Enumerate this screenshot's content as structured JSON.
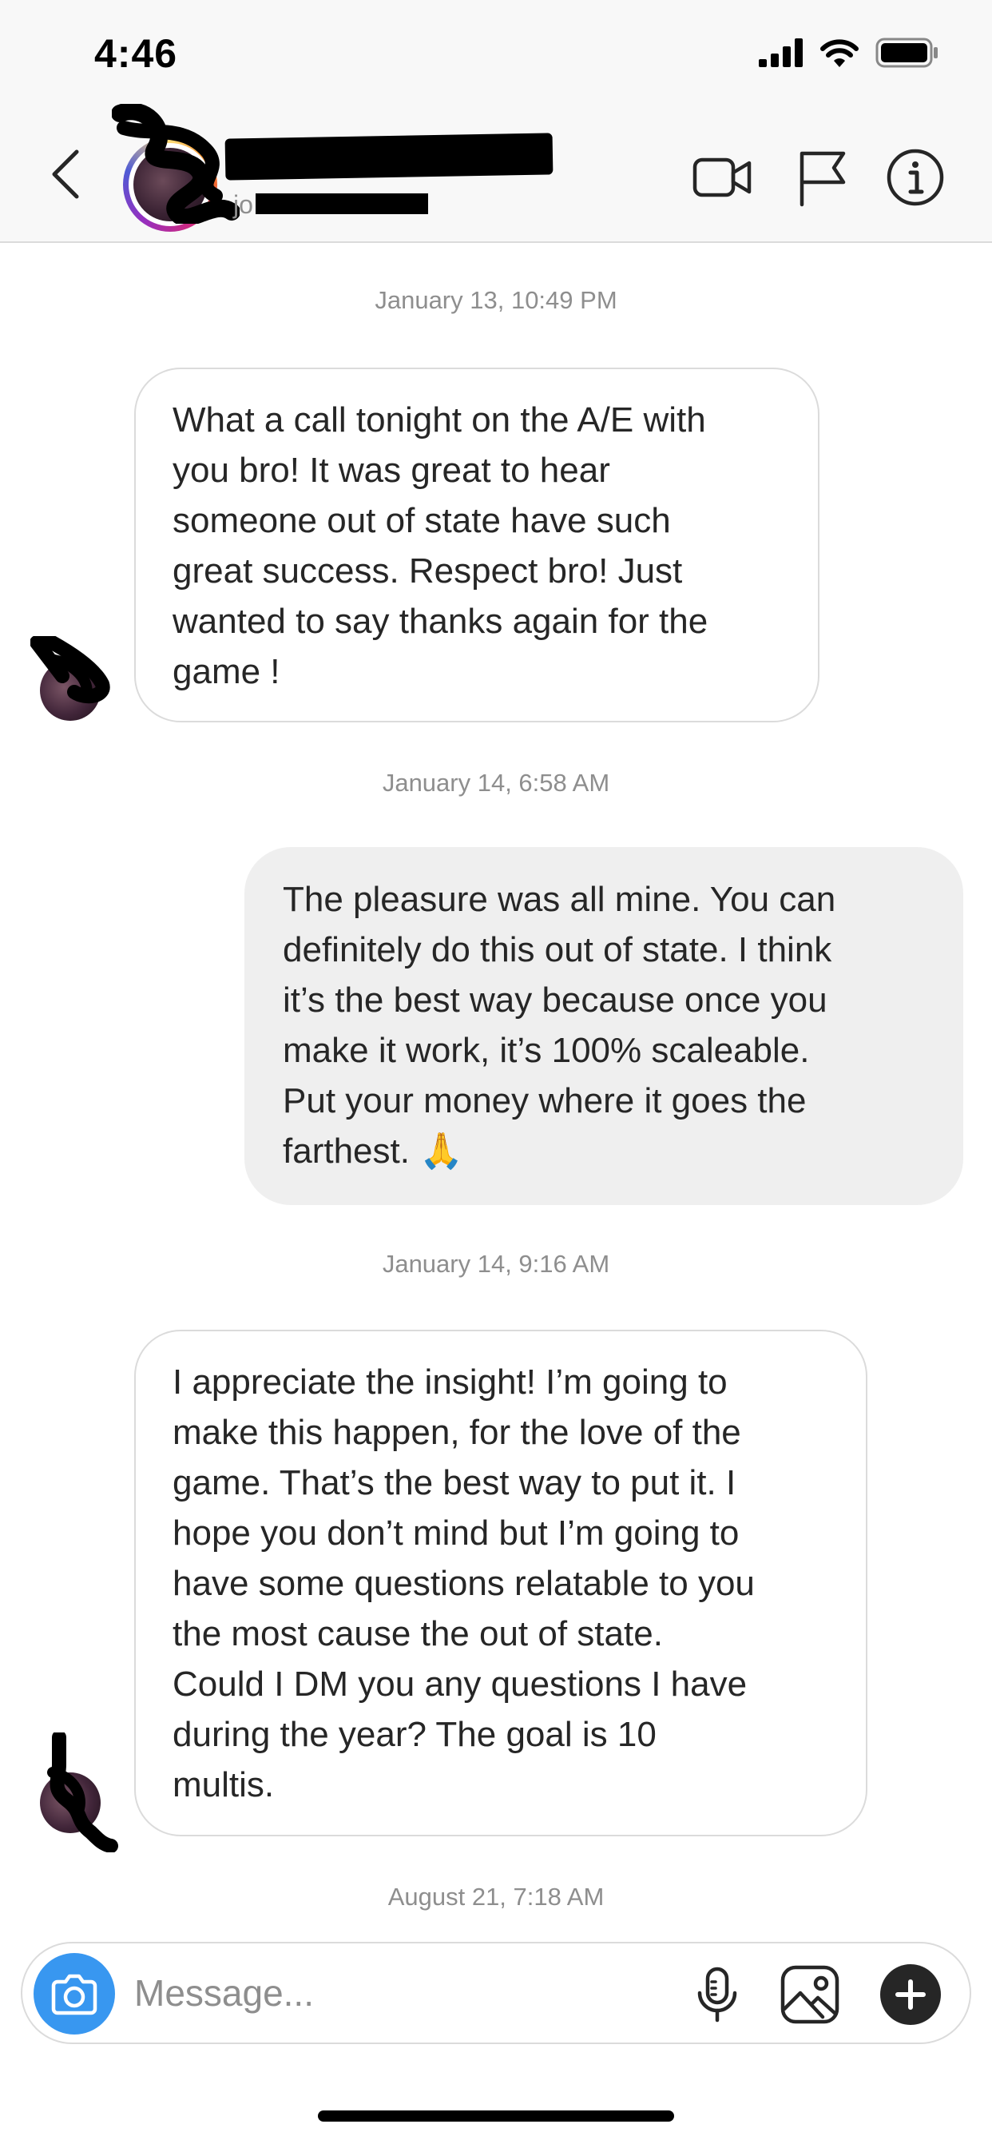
{
  "status_bar": {
    "time": "4:46",
    "icons": [
      "cellular-signal-icon",
      "wifi-icon",
      "battery-icon"
    ]
  },
  "header": {
    "name": "",
    "username": "jo",
    "actions": [
      "video-call-icon",
      "flag-icon",
      "info-icon"
    ],
    "colors": {
      "background": "#f8f8f8",
      "divider": "#dbdbdb"
    }
  },
  "thread": {
    "messages": [
      {
        "timestamp": "January 13, 10:49 PM",
        "direction": "received",
        "lines": [
          "What a call tonight on the A/E with",
          "you bro! It was great to hear",
          "someone out of state have such",
          "great success. Respect bro! Just",
          "wanted to say thanks again for the",
          "game !"
        ]
      },
      {
        "timestamp": "January 14, 6:58 AM",
        "direction": "sent",
        "lines": [
          "The pleasure was all mine.  You can",
          "definitely do this out of state.  I think",
          "it’s the best way because once you",
          "make it work, it’s 100% scaleable.",
          "Put your money where it goes the",
          "farthest. 🙏"
        ]
      },
      {
        "timestamp": "January 14, 9:16 AM",
        "direction": "received",
        "lines": [
          "I appreciate the insight! I’m going to",
          "make this happen, for the love of the",
          "game. That’s the best way to put it. I",
          "hope you don’t mind but I’m going to",
          "have some questions relatable to you",
          "the most cause the out of state.",
          "Could I DM you any questions I have",
          "during the year? The goal is 10",
          "multis."
        ]
      }
    ],
    "last_timestamp": "August 21, 7:18 AM"
  },
  "composer": {
    "placeholder": "Message...",
    "icons": [
      "camera-icon",
      "microphone-icon",
      "gallery-icon",
      "plus-icon"
    ],
    "colors": {
      "camera_button": "#3897f0",
      "plus_button": "#262626"
    }
  }
}
